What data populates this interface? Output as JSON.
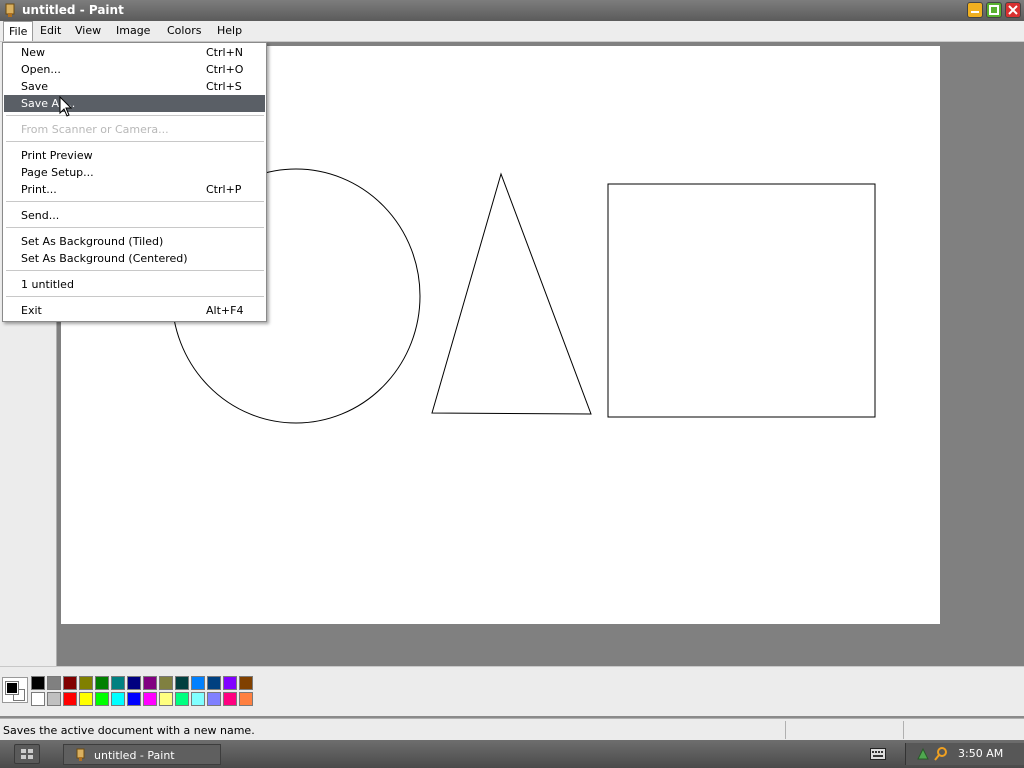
{
  "window": {
    "title": "untitled - Paint"
  },
  "menubar": {
    "items": [
      "File",
      "Edit",
      "View",
      "Image",
      "Colors",
      "Help"
    ]
  },
  "file_menu": {
    "items": [
      {
        "label": "New",
        "shortcut": "Ctrl+N",
        "state": "normal"
      },
      {
        "label": "Open...",
        "shortcut": "Ctrl+O",
        "state": "normal"
      },
      {
        "label": "Save",
        "shortcut": "Ctrl+S",
        "state": "normal"
      },
      {
        "label": "Save As...",
        "shortcut": "",
        "state": "selected"
      },
      {
        "label": "From Scanner or Camera...",
        "shortcut": "",
        "state": "disabled"
      },
      {
        "label": "Print Preview",
        "shortcut": "",
        "state": "normal"
      },
      {
        "label": "Page Setup...",
        "shortcut": "",
        "state": "normal"
      },
      {
        "label": "Print...",
        "shortcut": "Ctrl+P",
        "state": "normal"
      },
      {
        "label": "Send...",
        "shortcut": "",
        "state": "normal"
      },
      {
        "label": "Set As Background (Tiled)",
        "shortcut": "",
        "state": "normal"
      },
      {
        "label": "Set As Background (Centered)",
        "shortcut": "",
        "state": "normal"
      },
      {
        "label": "1 untitled",
        "shortcut": "",
        "state": "normal"
      },
      {
        "label": "Exit",
        "shortcut": "Alt+F4",
        "state": "normal"
      }
    ]
  },
  "palette": {
    "foreground": "#000000",
    "background": "#ffffff",
    "row1": [
      "#000000",
      "#808080",
      "#800000",
      "#808000",
      "#008000",
      "#008080",
      "#000080",
      "#800080",
      "#808040",
      "#004040",
      "#0080ff",
      "#004080",
      "#8000ff",
      "#804000"
    ],
    "row2": [
      "#ffffff",
      "#c0c0c0",
      "#ff0000",
      "#ffff00",
      "#00ff00",
      "#00ffff",
      "#0000ff",
      "#ff00ff",
      "#ffff80",
      "#00ff80",
      "#80ffff",
      "#8080ff",
      "#ff0080",
      "#ff8040"
    ]
  },
  "statusbar": {
    "text": "Saves the active document with a new name."
  },
  "taskbar": {
    "task_label": "untitled - Paint",
    "clock": "3:50 AM"
  }
}
